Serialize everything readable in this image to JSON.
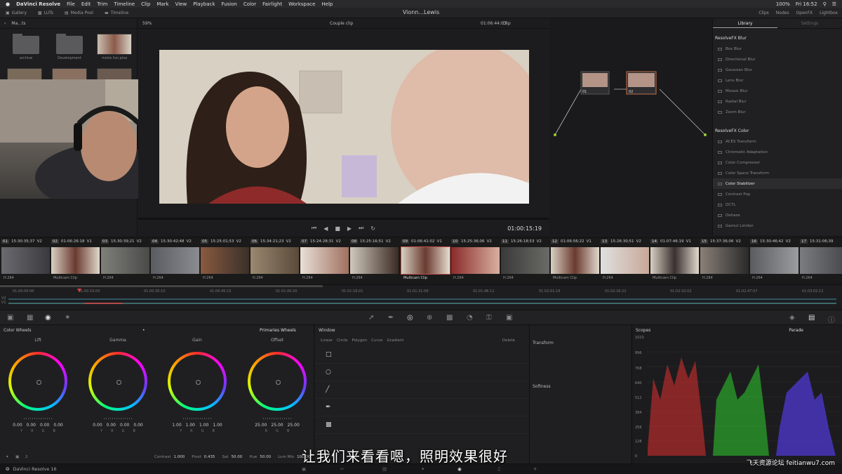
{
  "menubar": {
    "app": "DaVinci Resolve",
    "items": [
      "File",
      "Edit",
      "Trim",
      "Timeline",
      "Clip",
      "Mark",
      "View",
      "Playback",
      "Fusion",
      "Color",
      "Fairlight",
      "Workspace",
      "Help"
    ],
    "battery": "100%",
    "clock": "Fri 16:52"
  },
  "toolbar": {
    "gallery": "Gallery",
    "luts": "LUTs",
    "media_pool": "Media Pool",
    "timeline": "Timeline",
    "project_title": "Vionn...Lewis",
    "clips": "Clips",
    "nodes": "Nodes",
    "openfx": "OpenFX",
    "lightbox": "Lightbox"
  },
  "media_pool": {
    "path": "Ma...ts",
    "folders": [
      "archive",
      "Development",
      "moire fun.pixa"
    ]
  },
  "viewer": {
    "zoom": "59%",
    "clip_name": "Couple clip",
    "source_tc": "01:06:44:03",
    "timecode": "01:00:15:19",
    "mode": "Clip"
  },
  "nodes": {
    "labels": [
      "01",
      "02"
    ]
  },
  "library": {
    "tabs": [
      "Library",
      "Settings"
    ],
    "blur_title": "ResolveFX Blur",
    "blur": [
      "Box Blur",
      "Directional Blur",
      "Gaussian Blur",
      "Lens Blur",
      "Mosaic Blur",
      "Radial Blur",
      "Zoom Blur"
    ],
    "color_title": "ResolveFX Color",
    "color": [
      "ACES Transform",
      "Chromatic Adaptation",
      "Color Compressor",
      "Color Space Transform",
      "Color Stabilizer",
      "Contrast Pop",
      "DCTL",
      "Dehaze",
      "Gamut Limiter"
    ]
  },
  "clips": [
    {
      "num": "01",
      "tc": "15:30:35;37",
      "track": "V2",
      "label": "H.264"
    },
    {
      "num": "02",
      "tc": "01:06:26:18",
      "track": "V1",
      "label": "Multicam Clip"
    },
    {
      "num": "03",
      "tc": "15:30:39;21",
      "track": "V2",
      "label": "H.264"
    },
    {
      "num": "04",
      "tc": "15:30:42;48",
      "track": "V2",
      "label": "H.264"
    },
    {
      "num": "05",
      "tc": "15:25:01;53",
      "track": "V2",
      "label": "H.264"
    },
    {
      "num": "06",
      "tc": "15:34:21;23",
      "track": "V2",
      "label": "H.264"
    },
    {
      "num": "07",
      "tc": "15:24:28;31",
      "track": "V2",
      "label": "H.264"
    },
    {
      "num": "08",
      "tc": "15:25:16;51",
      "track": "V2",
      "label": "H.264"
    },
    {
      "num": "09",
      "tc": "01:06:41:02",
      "track": "V1",
      "label": "Multicam Clip"
    },
    {
      "num": "10",
      "tc": "15:25:36;06",
      "track": "V2",
      "label": "H.264"
    },
    {
      "num": "11",
      "tc": "15:26:18;53",
      "track": "V2",
      "label": "H.264"
    },
    {
      "num": "12",
      "tc": "01:06:56:22",
      "track": "V1",
      "label": "Multicam Clip"
    },
    {
      "num": "13",
      "tc": "15:26:30;51",
      "track": "V2",
      "label": "H.264"
    },
    {
      "num": "14",
      "tc": "01:07:46:19",
      "track": "V1",
      "label": "Multicam Clip"
    },
    {
      "num": "15",
      "tc": "15:37:36;06",
      "track": "V2",
      "label": "H.264"
    },
    {
      "num": "16",
      "tc": "15:30:46;42",
      "track": "V2",
      "label": "H.264"
    },
    {
      "num": "17",
      "tc": "15:31:06;39",
      "track": "V2",
      "label": "H.264"
    }
  ],
  "ruler": {
    "ticks": [
      "01:00:00:00",
      "01:00:15:05",
      "01:00:30:10",
      "01:00:45:15",
      "01:01:00:20",
      "01:01:16:01",
      "01:01:31:06",
      "01:01:46:11",
      "01:02:01:16",
      "01:02:16:21",
      "01:02:32:02",
      "01:02:47:07",
      "01:03:02:12"
    ],
    "tracks": [
      "V2",
      "V1"
    ]
  },
  "color_wheels": {
    "title": "Color Wheels",
    "mode": "Primaries Wheels",
    "wheels": [
      {
        "name": "Lift",
        "vals": [
          "0.00",
          "0.00",
          "0.00",
          "0.00"
        ]
      },
      {
        "name": "Gamma",
        "vals": [
          "0.00",
          "0.00",
          "0.00",
          "0.00"
        ]
      },
      {
        "name": "Gain",
        "vals": [
          "1.00",
          "1.00",
          "1.00",
          "1.00"
        ]
      },
      {
        "name": "Offset",
        "vals": [
          "25.00",
          "25.00",
          "25.00"
        ]
      }
    ],
    "channels": [
      "Y",
      "R",
      "G",
      "B"
    ],
    "page_num": "2",
    "contrast_label": "Contrast",
    "contrast": "1.000",
    "pivot_label": "Pivot",
    "pivot": "0.435",
    "sat_label": "Sat",
    "sat": "50.00",
    "hue_label": "Hue",
    "hue": "50.00",
    "lummix_label": "Lum Mix",
    "lummix": "100.00"
  },
  "window": {
    "title": "Window",
    "tools": [
      "Linear",
      "Circle",
      "Polygon",
      "Curve",
      "Gradient"
    ],
    "delete": "Delete"
  },
  "transform": {
    "title": "Transform",
    "softness": "Softness"
  },
  "scopes": {
    "title": "Scopes",
    "mode": "Parade",
    "scale": [
      "1023",
      "896",
      "768",
      "640",
      "512",
      "384",
      "256",
      "128",
      "0"
    ]
  },
  "footer": {
    "app": "DaVinci Resolve 16"
  },
  "subtitle": "让我们来看看嗯，照明效果很好",
  "watermark": "飞天资源论坛 feitianwu7.com"
}
